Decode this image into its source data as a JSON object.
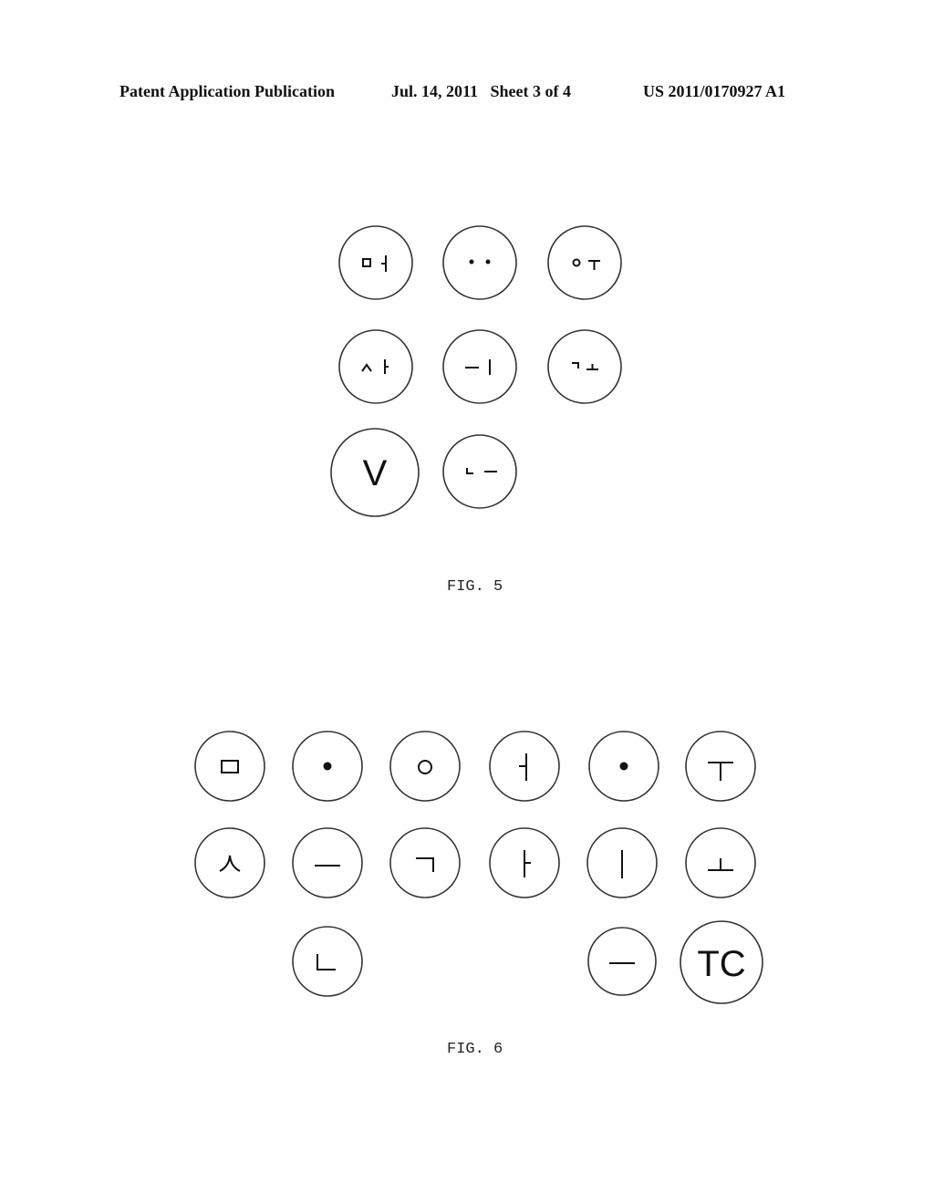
{
  "header": {
    "publication_type": "Patent Application Publication",
    "date_sheet": "Jul. 14, 2011   Sheet 3 of 4",
    "publication_number": "US 2011/0170927 A1"
  },
  "figures": [
    {
      "caption": "FIG. 5",
      "keys": [
        {
          "row": 1,
          "col": 1,
          "glyph": "ㅁㅓ",
          "description": "square + eo vowel"
        },
        {
          "row": 1,
          "col": 2,
          "glyph": "••",
          "description": "two dots"
        },
        {
          "row": 1,
          "col": 3,
          "glyph": "ㅇㅜ",
          "description": "circle + u vowel"
        },
        {
          "row": 2,
          "col": 1,
          "glyph": "ㅅㅏ",
          "description": "siot + a vowel"
        },
        {
          "row": 2,
          "col": 2,
          "glyph": "ㅡㅣ",
          "description": "eu + i vowels"
        },
        {
          "row": 2,
          "col": 3,
          "glyph": "ㄱㅗ",
          "description": "giyeok + o vowel"
        },
        {
          "row": 3,
          "col": 1,
          "glyph": "V",
          "description": "V key (larger)"
        },
        {
          "row": 3,
          "col": 2,
          "glyph": "ㄴㅡ",
          "description": "nieun + eu vowel"
        }
      ]
    },
    {
      "caption": "FIG. 6",
      "keys": [
        {
          "row": 1,
          "col": 1,
          "glyph": "ㅁ"
        },
        {
          "row": 1,
          "col": 2,
          "glyph": "•"
        },
        {
          "row": 1,
          "col": 3,
          "glyph": "ㅇ"
        },
        {
          "row": 1,
          "col": 4,
          "glyph": "ㅓ"
        },
        {
          "row": 1,
          "col": 5,
          "glyph": "•"
        },
        {
          "row": 1,
          "col": 6,
          "glyph": "ㅜ"
        },
        {
          "row": 2,
          "col": 1,
          "glyph": "ㅅ"
        },
        {
          "row": 2,
          "col": 2,
          "glyph": "ㅡ"
        },
        {
          "row": 2,
          "col": 3,
          "glyph": "ㄱ"
        },
        {
          "row": 2,
          "col": 4,
          "glyph": "ㅏ"
        },
        {
          "row": 2,
          "col": 5,
          "glyph": "ㅣ"
        },
        {
          "row": 2,
          "col": 6,
          "glyph": "ㅗ"
        },
        {
          "row": 3,
          "col": 2,
          "glyph": "ㄴ"
        },
        {
          "row": 3,
          "col": 5,
          "glyph": "ㅡ"
        },
        {
          "row": 3,
          "col": 6,
          "glyph": "TC"
        }
      ]
    }
  ]
}
